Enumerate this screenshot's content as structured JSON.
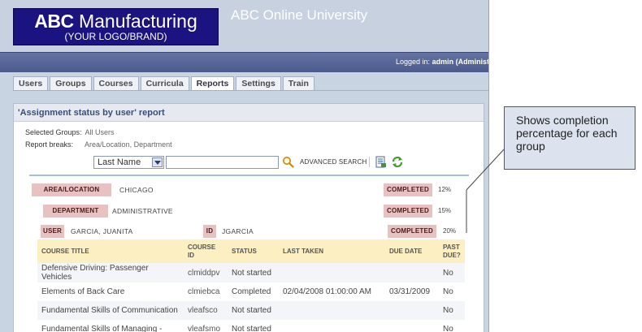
{
  "header": {
    "logo_brand": "Manufacturing",
    "logo_abc": "ABC",
    "logo_sub": "(YOUR LOGO/BRAND)",
    "site_title": "ABC Online University"
  },
  "topbar": {
    "login_prefix": "Logged in:",
    "login_user": "admin (Administr"
  },
  "tabs": [
    "Users",
    "Groups",
    "Courses",
    "Curricula",
    "Reports",
    "Settings",
    "Train"
  ],
  "active_tab": "Reports",
  "report": {
    "title": "'Assignment status by user' report",
    "selected_groups_label": "Selected Groups:",
    "selected_groups_value": "All Users",
    "report_breaks_label": "Report breaks:",
    "report_breaks_value": "Area/Location, Department"
  },
  "search": {
    "sort_value": "Last Name",
    "input_value": "",
    "advanced_label": "ADVANCED SEARCH"
  },
  "groups": {
    "area_label": "AREA/LOCATION",
    "area_value": "CHICAGO",
    "area_completed_label": "COMPLETED",
    "area_completed_pct": "12%",
    "dept_label": "DEPARTMENT",
    "dept_value": "ADMINISTRATIVE",
    "dept_completed_label": "COMPLETED",
    "dept_completed_pct": "15%",
    "user_label": "USER",
    "user_value": "GARCIA, JUANITA",
    "id_label": "ID",
    "id_value": "JGARCIA",
    "user_completed_label": "COMPLETED",
    "user_completed_pct": "20%"
  },
  "table": {
    "columns": [
      "COURSE TITLE",
      "COURSE ID",
      "STATUS",
      "LAST TAKEN",
      "DUE DATE",
      "PAST DUE?"
    ],
    "rows": [
      [
        "Defensive Driving: Passenger Vehicles",
        "clmiddpv",
        "Not started",
        "",
        "",
        "No"
      ],
      [
        "Elements of Back Care",
        "clmiebca",
        "Completed",
        "02/04/2008 01:00:00 AM",
        "03/31/2009",
        "No"
      ],
      [
        "Fundamental Skills of Communication",
        "vleafsco",
        "Not started",
        "",
        "",
        "No"
      ],
      [
        "Fundamental Skills of Managing -",
        "vleafsmo",
        "Not started",
        "",
        "",
        "No"
      ]
    ]
  },
  "callout": {
    "text": "Shows completion percentage for each group"
  },
  "colors": {
    "logo_bg": "#1b1380",
    "topbar": "#55649a",
    "tag_bg": "#e8c2c0",
    "table_header": "#fcefc2"
  }
}
